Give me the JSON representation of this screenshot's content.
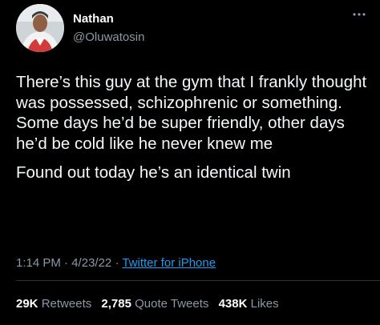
{
  "user": {
    "name": "Nathan",
    "handle": "@Oluwatosin"
  },
  "tweet": {
    "paragraphs": [
      "There’s this guy at the gym that I frankly thought was possessed, schizophrenic or something. Some days he’d be super friendly, other days he’d be cold like he never knew me",
      "Found out today he’s an identical twin"
    ],
    "time": "1:14 PM",
    "date": "4/23/22",
    "sep": "·",
    "source": "Twitter for iPhone"
  },
  "stats": {
    "retweets_count": "29K",
    "retweets_label": "Retweets",
    "quotes_count": "2,785",
    "quotes_label": "Quote Tweets",
    "likes_count": "438K",
    "likes_label": "Likes"
  },
  "icons": {
    "more": "more-horizontal-icon"
  },
  "colors": {
    "background": "#000000",
    "text": "#e7e9ea",
    "muted": "#8b98a5",
    "link": "#1d9bf0"
  }
}
